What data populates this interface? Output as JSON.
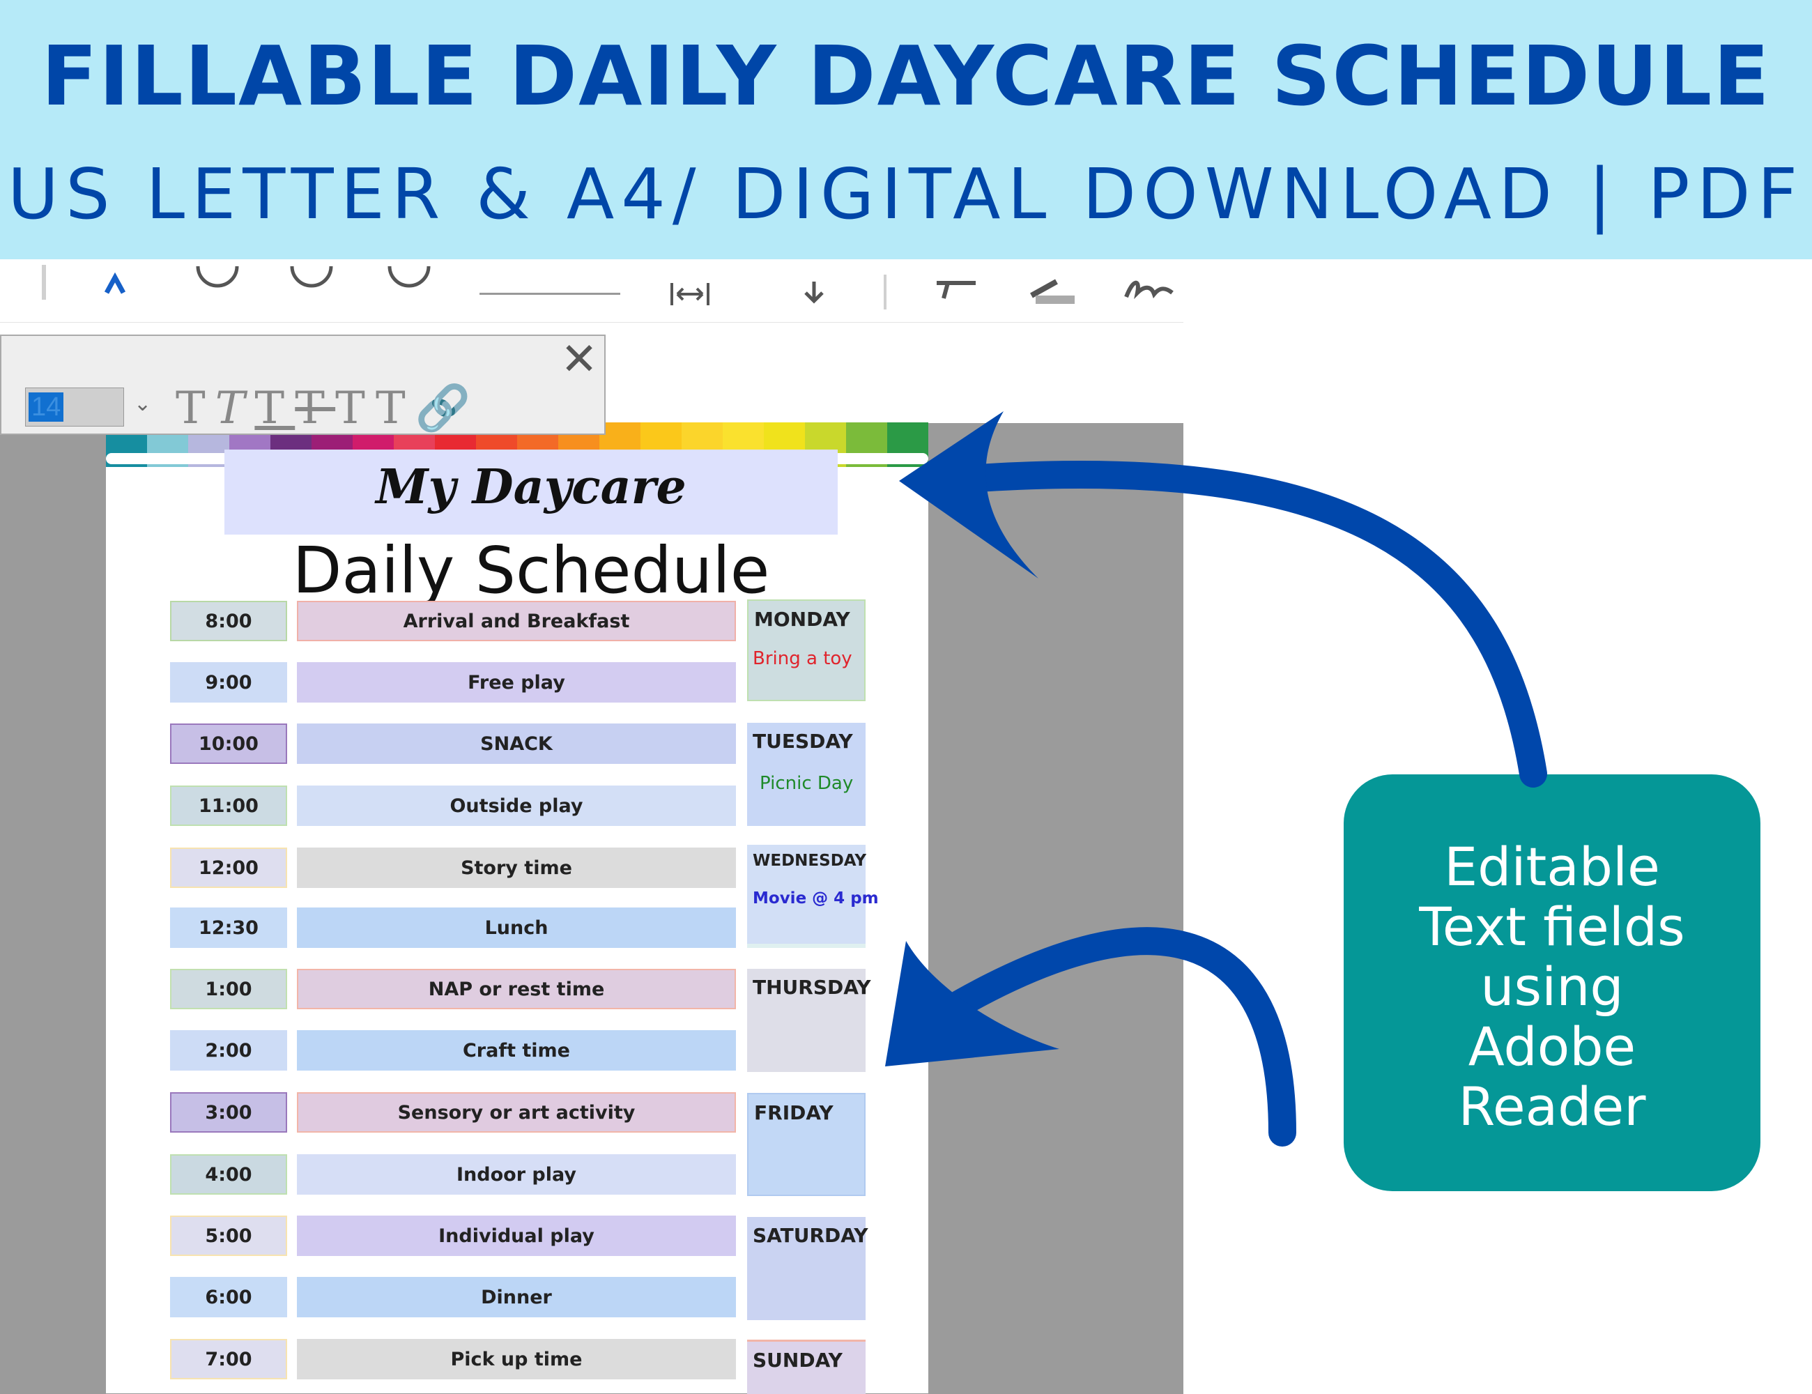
{
  "banner": {
    "title": "FILLABLE DAILY DAYCARE SCHEDULE",
    "subtitle": "US LETTER  & A4/  DIGITAL DOWNLOAD | PDF"
  },
  "toolbar": {
    "font_size": "14",
    "icons": [
      "pointer-icon",
      "circle-icon",
      "circle-icon",
      "circle-icon",
      "fit-width-icon",
      "download-icon",
      "comment-icon",
      "highlight-icon",
      "sign-icon"
    ]
  },
  "format_panel": {
    "text_style_icons": [
      "bold-text-icon",
      "italic-text-icon",
      "underline-text-icon",
      "strikethrough-text-icon",
      "superscript-text-icon",
      "subscript-text-icon",
      "link-icon"
    ]
  },
  "document": {
    "header": "My Daycare",
    "subtitle": "Daily Schedule",
    "rows": [
      {
        "time": "8:00",
        "activity": "Arrival and Breakfast"
      },
      {
        "time": "9:00",
        "activity": "Free play"
      },
      {
        "time": "10:00",
        "activity": "SNACK"
      },
      {
        "time": "11:00",
        "activity": "Outside play"
      },
      {
        "time": "12:00",
        "activity": "Story time"
      },
      {
        "time": "12:30",
        "activity": "Lunch"
      },
      {
        "time": "1:00",
        "activity": "NAP or rest time"
      },
      {
        "time": "2:00",
        "activity": "Craft time"
      },
      {
        "time": "3:00",
        "activity": "Sensory or art activity"
      },
      {
        "time": "4:00",
        "activity": "Indoor play"
      },
      {
        "time": "5:00",
        "activity": "Individual play"
      },
      {
        "time": "6:00",
        "activity": "Dinner"
      },
      {
        "time": "7:00",
        "activity": "Pick up time"
      }
    ],
    "days": [
      {
        "name": "MONDAY",
        "note": "Bring a toy",
        "note_color": "#e0242c"
      },
      {
        "name": "TUESDAY",
        "note": "Picnic Day",
        "note_color": "#1f8a2a"
      },
      {
        "name": "WEDNESDAY",
        "note": "Movie @ 4 pm",
        "note_color": "#2a2ad0"
      },
      {
        "name": "THURSDAY",
        "note": ""
      },
      {
        "name": "FRIDAY",
        "note": ""
      },
      {
        "name": "SATURDAY",
        "note": ""
      },
      {
        "name": "SUNDAY",
        "note": ""
      }
    ]
  },
  "callout": {
    "line1": "Editable",
    "line2": "Text fields",
    "line3": "using",
    "line4": "Adobe",
    "line5": "Reader"
  },
  "colors": {
    "banner_bg": "#b6eaf8",
    "banner_text": "#0046a8",
    "callout_bg": "#059797",
    "arrow": "#0047ab"
  }
}
